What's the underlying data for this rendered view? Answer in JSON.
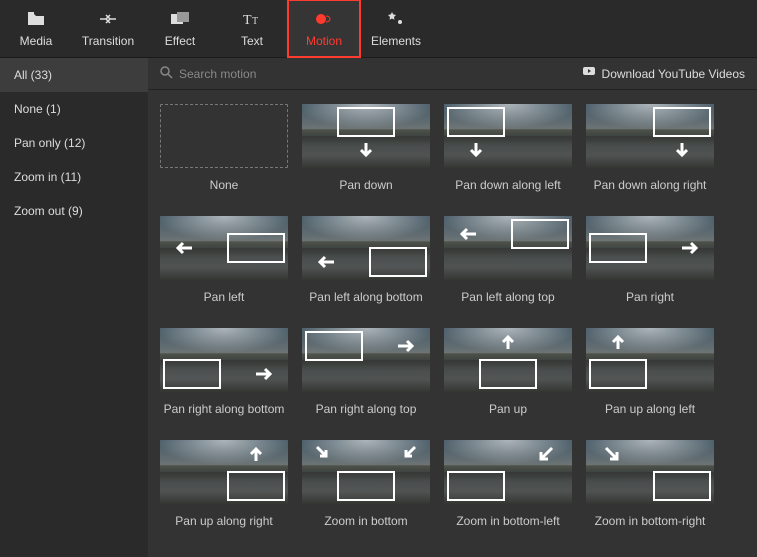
{
  "topTabs": [
    {
      "id": "media",
      "label": "Media"
    },
    {
      "id": "transition",
      "label": "Transition"
    },
    {
      "id": "effect",
      "label": "Effect"
    },
    {
      "id": "text",
      "label": "Text"
    },
    {
      "id": "motion",
      "label": "Motion",
      "active": true
    },
    {
      "id": "elements",
      "label": "Elements"
    }
  ],
  "sidebar": {
    "items": [
      {
        "label": "All (33)",
        "active": true
      },
      {
        "label": "None (1)"
      },
      {
        "label": "Pan only (12)"
      },
      {
        "label": "Zoom in (11)"
      },
      {
        "label": "Zoom out (9)"
      }
    ]
  },
  "search": {
    "placeholder": "Search motion"
  },
  "downloadLink": "Download YouTube Videos",
  "motions": [
    {
      "label": "None",
      "type": "none"
    },
    {
      "label": "Pan down"
    },
    {
      "label": "Pan down along left"
    },
    {
      "label": "Pan down along right"
    },
    {
      "label": "Pan left"
    },
    {
      "label": "Pan left along bottom"
    },
    {
      "label": "Pan left along top"
    },
    {
      "label": "Pan right"
    },
    {
      "label": "Pan right along bottom"
    },
    {
      "label": "Pan right along top"
    },
    {
      "label": "Pan up"
    },
    {
      "label": "Pan up along left"
    },
    {
      "label": "Pan up along right"
    },
    {
      "label": "Zoom in bottom"
    },
    {
      "label": "Zoom in bottom-left"
    },
    {
      "label": "Zoom in bottom-right"
    }
  ]
}
